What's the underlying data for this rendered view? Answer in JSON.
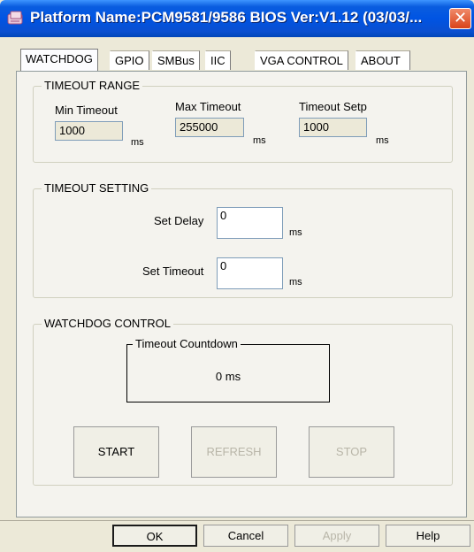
{
  "window": {
    "title": "Platform Name:PCM9581/9586   BIOS Ver:V1.12 (03/03/...",
    "close_glyph": "✕"
  },
  "tabs": [
    {
      "label": "WATCHDOG"
    },
    {
      "label": "GPIO"
    },
    {
      "label": "SMBus"
    },
    {
      "label": "IIC"
    },
    {
      "label": "VGA CONTROL"
    },
    {
      "label": "ABOUT"
    }
  ],
  "timeout_range": {
    "legend": "TIMEOUT RANGE",
    "min_label": "Min Timeout",
    "min_value": "1000",
    "max_label": "Max Timeout",
    "max_value": "255000",
    "step_label": "Timeout Setp",
    "step_value": "1000",
    "unit": "ms"
  },
  "timeout_setting": {
    "legend": "TIMEOUT SETTING",
    "delay_label": "Set Delay",
    "delay_value": "0",
    "timeout_label": "Set Timeout",
    "timeout_value": "0",
    "unit": "ms"
  },
  "watchdog_control": {
    "legend": "WATCHDOG CONTROL",
    "countdown_legend": "Timeout Countdown",
    "countdown_value": "0  ms",
    "start_label": "START",
    "refresh_label": "REFRESH",
    "stop_label": "STOP"
  },
  "dialog_buttons": {
    "ok": "OK",
    "cancel": "Cancel",
    "apply": "Apply",
    "help": "Help"
  }
}
